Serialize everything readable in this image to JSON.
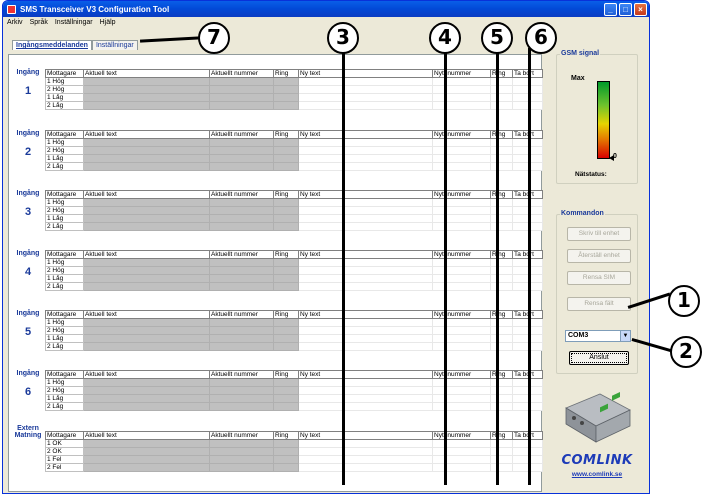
{
  "window": {
    "title": "SMS Transceiver V3 Configuration Tool",
    "minimize": "_",
    "maximize": "□",
    "close": "×"
  },
  "menu": [
    "Arkiv",
    "Språk",
    "Inställningar",
    "Hjälp"
  ],
  "tabs": [
    {
      "label": "Ingångsmeddelanden",
      "active": true
    },
    {
      "label": "Inställningar",
      "active": false
    }
  ],
  "table_headers": [
    "Mottagare",
    "Aktuell text",
    "Aktuellt nummer",
    "Ring",
    "Ny text",
    "Nytt nummer",
    "Ring",
    "Ta bort"
  ],
  "groups": [
    {
      "title": "Ingång",
      "number": "1",
      "rows": [
        "1 Hög",
        "2 Hög",
        "1 Låg",
        "2 Låg"
      ]
    },
    {
      "title": "Ingång",
      "number": "2",
      "rows": [
        "1 Hög",
        "2 Hög",
        "1 Låg",
        "2 Låg"
      ]
    },
    {
      "title": "Ingång",
      "number": "3",
      "rows": [
        "1 Hög",
        "2 Hög",
        "1 Låg",
        "2 Låg"
      ]
    },
    {
      "title": "Ingång",
      "number": "4",
      "rows": [
        "1 Hög",
        "2 Hög",
        "1 Låg",
        "2 Låg"
      ]
    },
    {
      "title": "Ingång",
      "number": "5",
      "rows": [
        "1 Hög",
        "2 Hög",
        "1 Låg",
        "2 Låg"
      ]
    },
    {
      "title": "Ingång",
      "number": "6",
      "rows": [
        "1 Hög",
        "2 Hög",
        "1 Låg",
        "2 Låg"
      ]
    },
    {
      "title": "Extern Matning",
      "number": "",
      "rows": [
        "1 OK",
        "2 OK",
        "1 Fel",
        "2 Fel"
      ]
    }
  ],
  "gsm": {
    "legend": "GSM signal",
    "max_label": "Max",
    "zero_label": "0",
    "net_status_label": "Nätstatus:"
  },
  "commands": {
    "legend": "Kommandon",
    "buttons": [
      "Skriv till enhet",
      "Återställ enhet",
      "Rensa SIM",
      "Rensa fält"
    ],
    "port_value": "COM3",
    "connect_label": "Anslut"
  },
  "logo": {
    "text": "COMLINK",
    "url": "www.comlink.se"
  },
  "annotations": [
    "1",
    "2",
    "3",
    "4",
    "5",
    "6",
    "7"
  ],
  "colors": {
    "title_bar": "#0249d6",
    "group_label": "#1a3a9a",
    "grey_cells": "#c0c0c0",
    "logo": "#1d3bb8"
  }
}
